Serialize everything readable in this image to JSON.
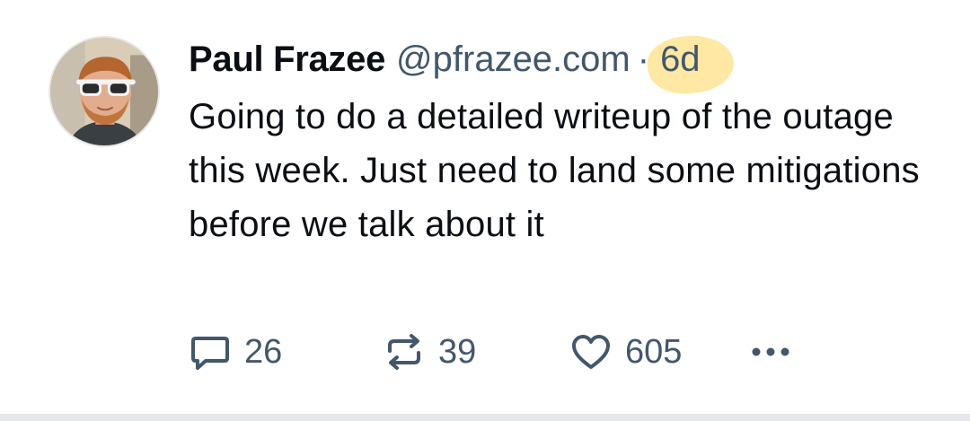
{
  "post": {
    "author": {
      "display_name": "Paul Frazee",
      "handle": "@pfrazee.com"
    },
    "separator": "·",
    "timestamp": "6d",
    "text": "Going to do a detailed writeup of the outage this week. Just need to land some mitigations before we talk about it",
    "actions": {
      "reply_count": "26",
      "repost_count": "39",
      "like_count": "605"
    }
  },
  "icons": {
    "reply": "speech-bubble-icon",
    "repost": "repost-arrows-icon",
    "like": "heart-icon",
    "more": "more-dots-icon"
  },
  "colors": {
    "text": "#0b0f14",
    "muted": "#42576c",
    "highlight": "#ffd65a",
    "divider": "#e5e7ea"
  }
}
